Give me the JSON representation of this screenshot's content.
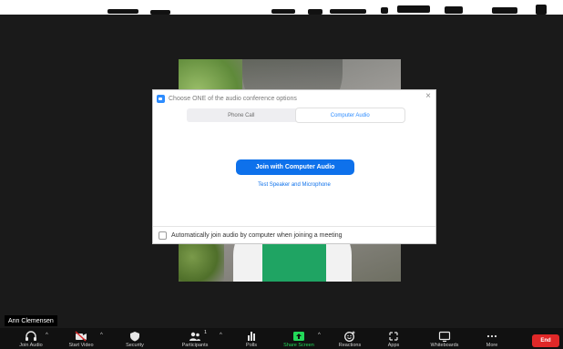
{
  "dialog": {
    "title": "Choose ONE of the audio conference options",
    "close_glyph": "×",
    "tabs": [
      {
        "label": "Phone Call",
        "active": false
      },
      {
        "label": "Computer Audio",
        "active": true
      }
    ],
    "join_button": "Join with Computer Audio",
    "test_link": "Test Speaker and Microphone",
    "auto_join_label": "Automatically join audio by computer when joining a meeting",
    "auto_join_checked": false
  },
  "participant": {
    "name": "Ann Clemensen"
  },
  "toolbar": {
    "items": [
      {
        "label": "Join Audio",
        "icon": "headphones-icon"
      },
      {
        "label": "Start Video",
        "icon": "video-off-icon"
      },
      {
        "label": "Security",
        "icon": "shield-icon"
      },
      {
        "label": "Participants",
        "icon": "participants-icon",
        "count": "1"
      },
      {
        "label": "Polls",
        "icon": "poll-icon"
      },
      {
        "label": "Share Screen",
        "icon": "share-screen-icon"
      },
      {
        "label": "Reactions",
        "icon": "emoji-icon"
      },
      {
        "label": "Apps",
        "icon": "apps-icon"
      },
      {
        "label": "Whiteboards",
        "icon": "whiteboard-icon"
      },
      {
        "label": "More",
        "icon": "more-icon"
      }
    ],
    "end_label": "End"
  },
  "colors": {
    "accent": "#0e71eb",
    "share_screen": "#23d959",
    "end": "#e02828",
    "background": "#1a1a1a"
  }
}
